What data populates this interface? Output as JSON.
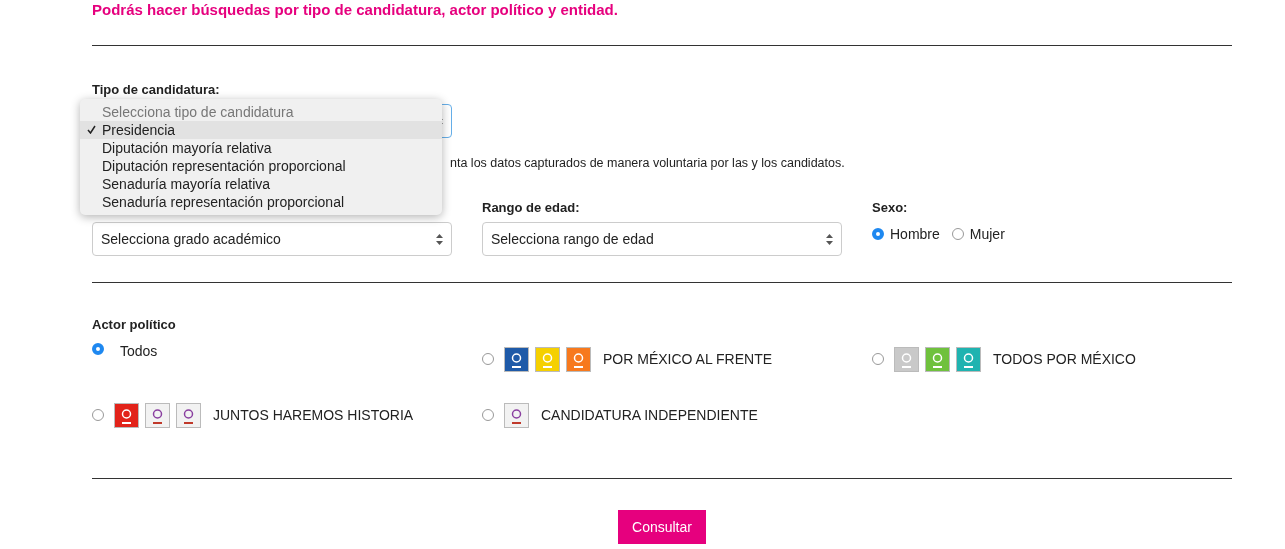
{
  "intro": "Podrás hacer búsquedas por tipo de candidatura, actor político y entidad.",
  "candidacy": {
    "label": "Tipo de candidatura:",
    "options": [
      {
        "label": "Selecciona tipo de candidatura",
        "kind": "placeholder",
        "selected": false
      },
      {
        "label": "Presidencia",
        "kind": "option",
        "selected": true
      },
      {
        "label": "Diputación mayoría relativa",
        "kind": "option",
        "selected": false
      },
      {
        "label": "Diputación representación proporcional",
        "kind": "option",
        "selected": false
      },
      {
        "label": "Senaduría mayoría relativa",
        "kind": "option",
        "selected": false
      },
      {
        "label": "Senaduría representación proporcional",
        "kind": "option",
        "selected": false
      }
    ]
  },
  "note": "nta los datos capturados de manera voluntaria por las y los candidatos.",
  "filters": [
    {
      "kind": "select",
      "placeholder": "Selecciona grado académico"
    },
    {
      "kind": "select",
      "label": "Rango de edad:",
      "placeholder": "Selecciona rango de edad"
    },
    {
      "kind": "radio",
      "label": "Sexo:",
      "options": [
        {
          "label": "Hombre",
          "selected": true
        },
        {
          "label": "Mujer",
          "selected": false
        }
      ]
    }
  ],
  "actor": {
    "label": "Actor político",
    "options": [
      {
        "label": "Todos",
        "selected": true
      },
      {
        "label": "POR MÉXICO AL FRENTE",
        "selected": false,
        "logos": [
          {
            "color": "#1e5aa8"
          },
          {
            "color": "#f5d000"
          },
          {
            "color": "#f7791d"
          }
        ]
      },
      {
        "label": "TODOS POR MÉXICO",
        "selected": false,
        "logos": [
          {
            "color": "#c9c9c9"
          },
          {
            "color": "#6fc13d"
          },
          {
            "color": "#1fb3b0"
          }
        ]
      },
      {
        "label": "JUNTOS HAREMOS HISTORIA",
        "selected": false,
        "logos": [
          {
            "color": "#e2231a"
          },
          {
            "color": "#f2f2f2"
          },
          {
            "color": "#f2f2f2"
          }
        ]
      },
      {
        "label": "CANDIDATURA INDEPENDIENTE",
        "selected": false,
        "logos": [
          {
            "color": "#f2f2f2"
          }
        ]
      }
    ]
  },
  "submit": "Consultar"
}
